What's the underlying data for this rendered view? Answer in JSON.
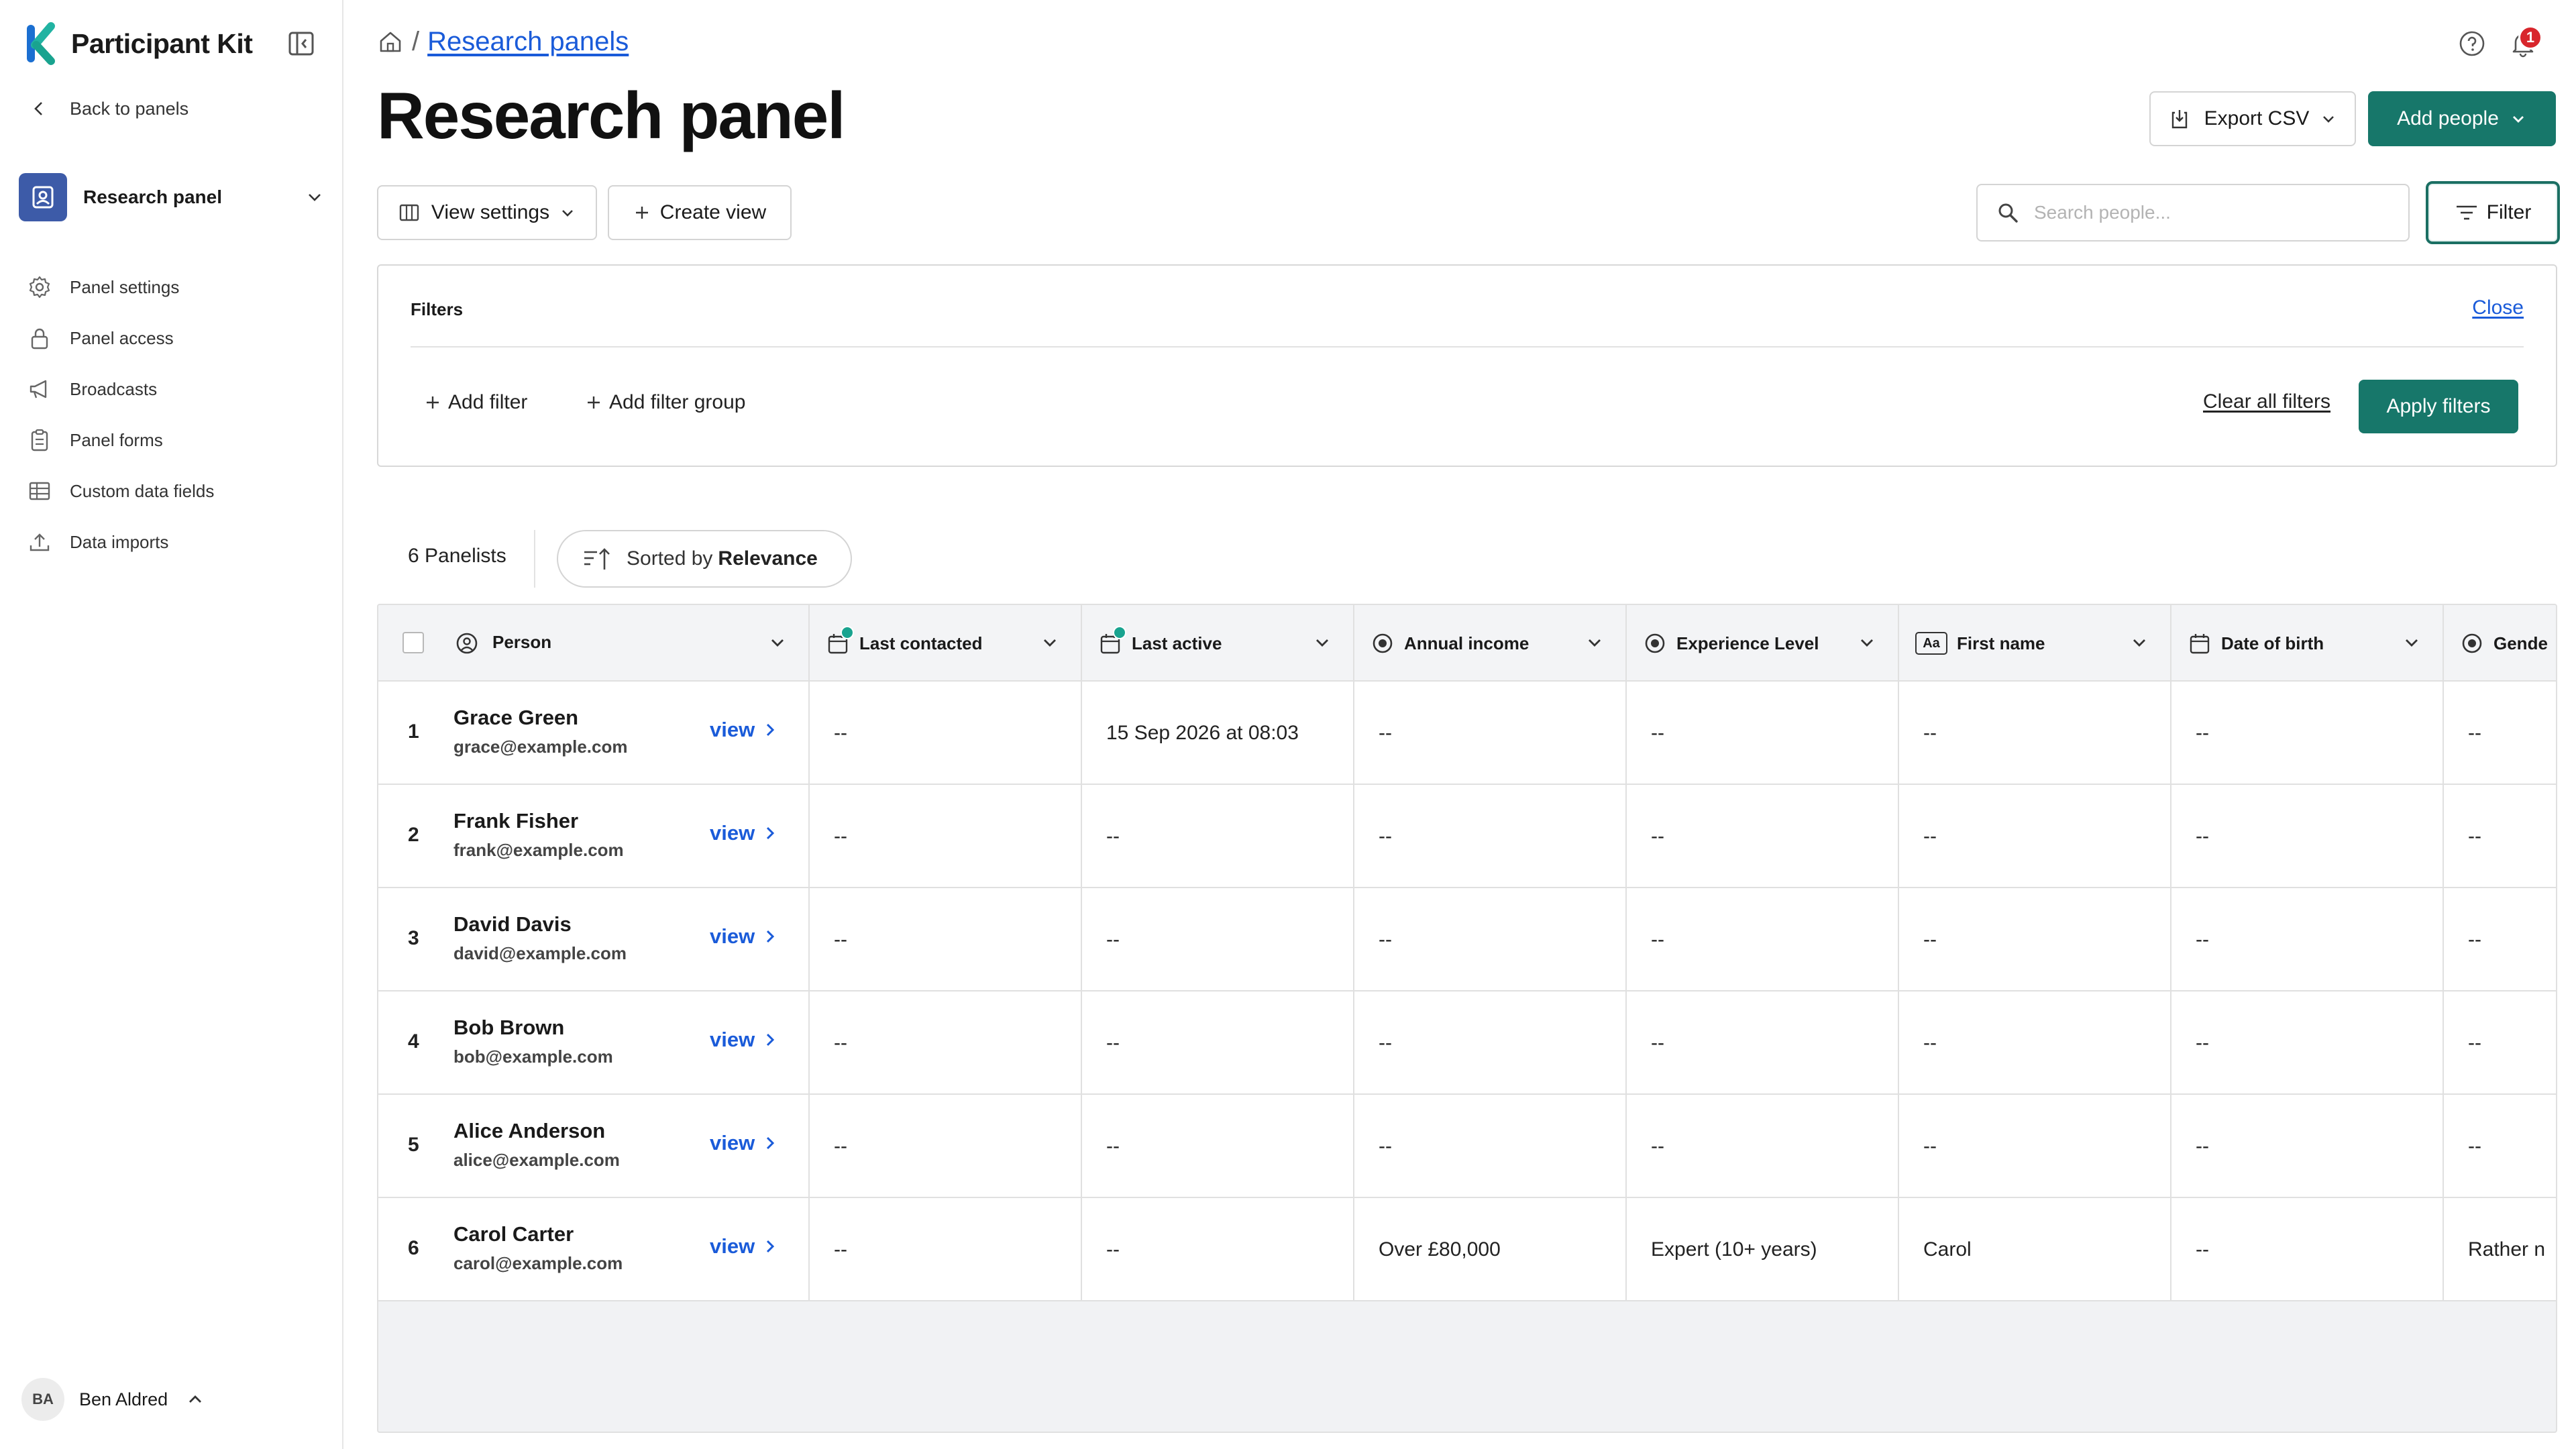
{
  "app": {
    "name": "Participant Kit"
  },
  "sidebar": {
    "back_label": "Back to panels",
    "panel_name": "Research panel",
    "items": [
      {
        "label": "Panel settings",
        "icon": "gear-icon"
      },
      {
        "label": "Panel access",
        "icon": "lock-icon"
      },
      {
        "label": "Broadcasts",
        "icon": "megaphone-icon"
      },
      {
        "label": "Panel forms",
        "icon": "clipboard-icon"
      },
      {
        "label": "Custom data fields",
        "icon": "table-icon"
      },
      {
        "label": "Data imports",
        "icon": "upload-icon"
      }
    ],
    "user": {
      "initials": "BA",
      "name": "Ben Aldred"
    }
  },
  "header": {
    "breadcrumb_link": "Research panels",
    "breadcrumb_sep": "/",
    "title": "Research panel",
    "notification_count": "1",
    "export_label": "Export CSV",
    "add_people_label": "Add people"
  },
  "toolbar": {
    "view_settings_label": "View settings",
    "create_view_label": "Create view",
    "search_placeholder": "Search people...",
    "filter_label": "Filter"
  },
  "filters": {
    "title": "Filters",
    "close_label": "Close",
    "add_filter_label": "Add filter",
    "add_filter_group_label": "Add filter group",
    "clear_label": "Clear all filters",
    "apply_label": "Apply filters"
  },
  "list": {
    "count_label": "6 Panelists",
    "sort_prefix": "Sorted by",
    "sort_value": "Relevance"
  },
  "colors": {
    "accent": "#17776a",
    "link": "#1a5bd9",
    "brand_icon": "#3d5ba8",
    "badge": "#d8262c"
  },
  "table": {
    "columns": [
      {
        "label": "Person",
        "icon": "person-circle-icon"
      },
      {
        "label": "Last contacted",
        "icon": "calendar-icon"
      },
      {
        "label": "Last active",
        "icon": "calendar-icon"
      },
      {
        "label": "Annual income",
        "icon": "radio-icon"
      },
      {
        "label": "Experience Level",
        "icon": "radio-icon"
      },
      {
        "label": "First name",
        "icon": "text-icon",
        "icon_text": "Aa"
      },
      {
        "label": "Date of birth",
        "icon": "calendar-icon"
      },
      {
        "label": "Gende",
        "icon": "radio-icon"
      }
    ],
    "view_label": "view",
    "rows": [
      {
        "num": "1",
        "name": "Grace Green",
        "email": "grace@example.com",
        "cells": [
          "--",
          "15 Sep 2026 at 08:03",
          "--",
          "--",
          "--",
          "--",
          "--"
        ]
      },
      {
        "num": "2",
        "name": "Frank Fisher",
        "email": "frank@example.com",
        "cells": [
          "--",
          "--",
          "--",
          "--",
          "--",
          "--",
          "--"
        ]
      },
      {
        "num": "3",
        "name": "David Davis",
        "email": "david@example.com",
        "cells": [
          "--",
          "--",
          "--",
          "--",
          "--",
          "--",
          "--"
        ]
      },
      {
        "num": "4",
        "name": "Bob Brown",
        "email": "bob@example.com",
        "cells": [
          "--",
          "--",
          "--",
          "--",
          "--",
          "--",
          "--"
        ]
      },
      {
        "num": "5",
        "name": "Alice Anderson",
        "email": "alice@example.com",
        "cells": [
          "--",
          "--",
          "--",
          "--",
          "--",
          "--",
          "--"
        ]
      },
      {
        "num": "6",
        "name": "Carol Carter",
        "email": "carol@example.com",
        "cells": [
          "--",
          "--",
          "Over £80,000",
          "Expert (10+ years)",
          "Carol",
          "--",
          "Rather n"
        ]
      }
    ]
  }
}
